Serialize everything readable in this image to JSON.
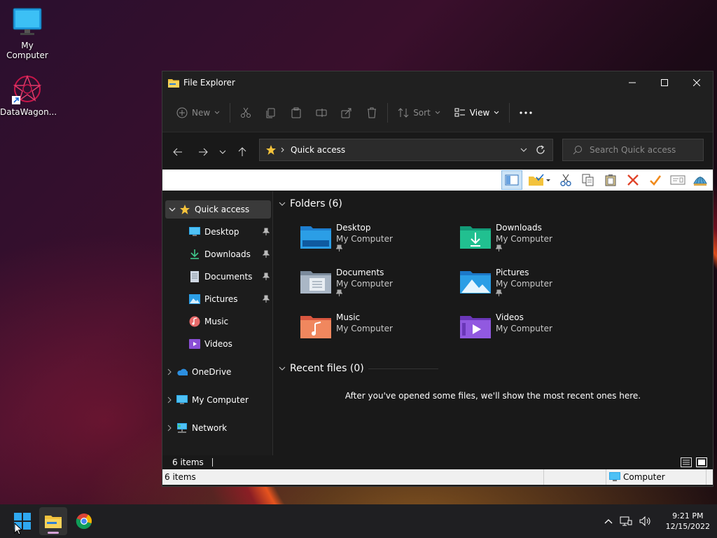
{
  "desktop": {
    "icons": [
      {
        "label": "My Computer",
        "icon": "monitor-icon"
      },
      {
        "label": "DataWagon...",
        "icon": "app-shortcut-icon"
      }
    ]
  },
  "window": {
    "title": "File Explorer",
    "commandbar": {
      "new_label": "New",
      "sort_label": "Sort",
      "view_label": "View"
    },
    "address": {
      "path": "Quick access"
    },
    "search": {
      "placeholder": "Search Quick access"
    },
    "sidebar": {
      "items": [
        {
          "label": "Quick access",
          "icon": "star-icon"
        },
        {
          "label": "Desktop",
          "icon": "desktop-icon"
        },
        {
          "label": "Downloads",
          "icon": "download-icon"
        },
        {
          "label": "Documents",
          "icon": "document-icon"
        },
        {
          "label": "Pictures",
          "icon": "pictures-icon"
        },
        {
          "label": "Music",
          "icon": "music-icon"
        },
        {
          "label": "Videos",
          "icon": "videos-icon"
        },
        {
          "label": "OneDrive",
          "icon": "cloud-icon"
        },
        {
          "label": "My Computer",
          "icon": "computer-icon"
        },
        {
          "label": "Network",
          "icon": "network-icon"
        }
      ]
    },
    "folders_header": "Folders (6)",
    "folders": [
      {
        "name": "Desktop",
        "location": "My Computer"
      },
      {
        "name": "Downloads",
        "location": "My Computer"
      },
      {
        "name": "Documents",
        "location": "My Computer"
      },
      {
        "name": "Pictures",
        "location": "My Computer"
      },
      {
        "name": "Music",
        "location": "My Computer"
      },
      {
        "name": "Videos",
        "location": "My Computer"
      }
    ],
    "recent_header": "Recent files (0)",
    "recent_empty": "After you've opened some files, we'll show the most recent ones here.",
    "status": {
      "item_count": "6 items",
      "bottom_count": "6 items",
      "location": "Computer"
    }
  },
  "taskbar": {
    "time": "9:21 PM",
    "date": "12/15/2022"
  }
}
